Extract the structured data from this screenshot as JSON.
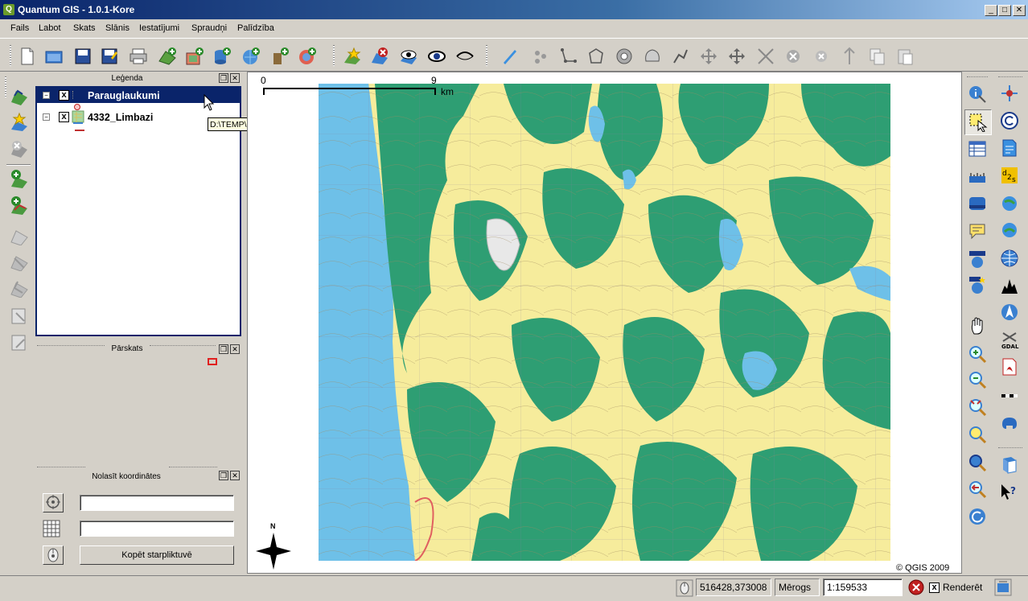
{
  "window": {
    "title": "Quantum GIS - 1.0.1-Kore",
    "logo": "Q"
  },
  "menu": [
    "Fails",
    "Labot",
    "Skats",
    "Slānis",
    "Iestatījumi",
    "Spraudņi",
    "Palīdzība"
  ],
  "panels": {
    "legend": {
      "title": "Leģenda",
      "layers": [
        {
          "name": "Parauglaukumi",
          "checked": "x",
          "selected": true
        },
        {
          "name": "4332_Limbazi",
          "checked": "x",
          "selected": false
        }
      ],
      "tooltip": "D:\\TEMP\\Parauglaukumi\\Parauglaukumi.shp"
    },
    "overview": {
      "title": "Pārskats"
    },
    "coords": {
      "title": "Nolasīt koordinātes",
      "field1": "",
      "field2": "",
      "copy_button": "Kopēt starpliktuvē"
    }
  },
  "map": {
    "scalebar": {
      "left": "0",
      "right": "9",
      "unit": "km"
    },
    "north": "N",
    "copyright": "© QGIS 2009",
    "colors": {
      "forest": "#2e9e73",
      "field": "#f6ec9c",
      "water": "#6ec0e8",
      "bg": "#ffffff"
    }
  },
  "status": {
    "coordinates": "516428,373008",
    "scale_label": "Mērogs",
    "scale_value": "1:159533",
    "render_label": "Renderēt",
    "render_checked": "x"
  },
  "icons": {
    "toolbar": [
      "new-project-icon",
      "open-project-icon",
      "save-project-icon",
      "save-as-icon",
      "print-icon",
      "add-vector-icon",
      "add-raster-icon",
      "add-postgis-icon",
      "add-wms-icon",
      "add-spatialite-icon",
      "add-wfs-icon",
      "new-vector-icon",
      "remove-layer-icon",
      "show-all-icon",
      "show-layer-icon",
      "hide-layer-icon",
      "capture-line-icon",
      "capture-point-icon",
      "capture-polyline-icon",
      "capture-polygon-icon",
      "add-ring-icon",
      "add-island-icon",
      "move-feature-icon",
      "move-vertex-icon",
      "add-vertex-icon",
      "delete-vertex-icon",
      "delete-selected-icon",
      "split-icon",
      "copy-icon",
      "paste-icon"
    ]
  }
}
